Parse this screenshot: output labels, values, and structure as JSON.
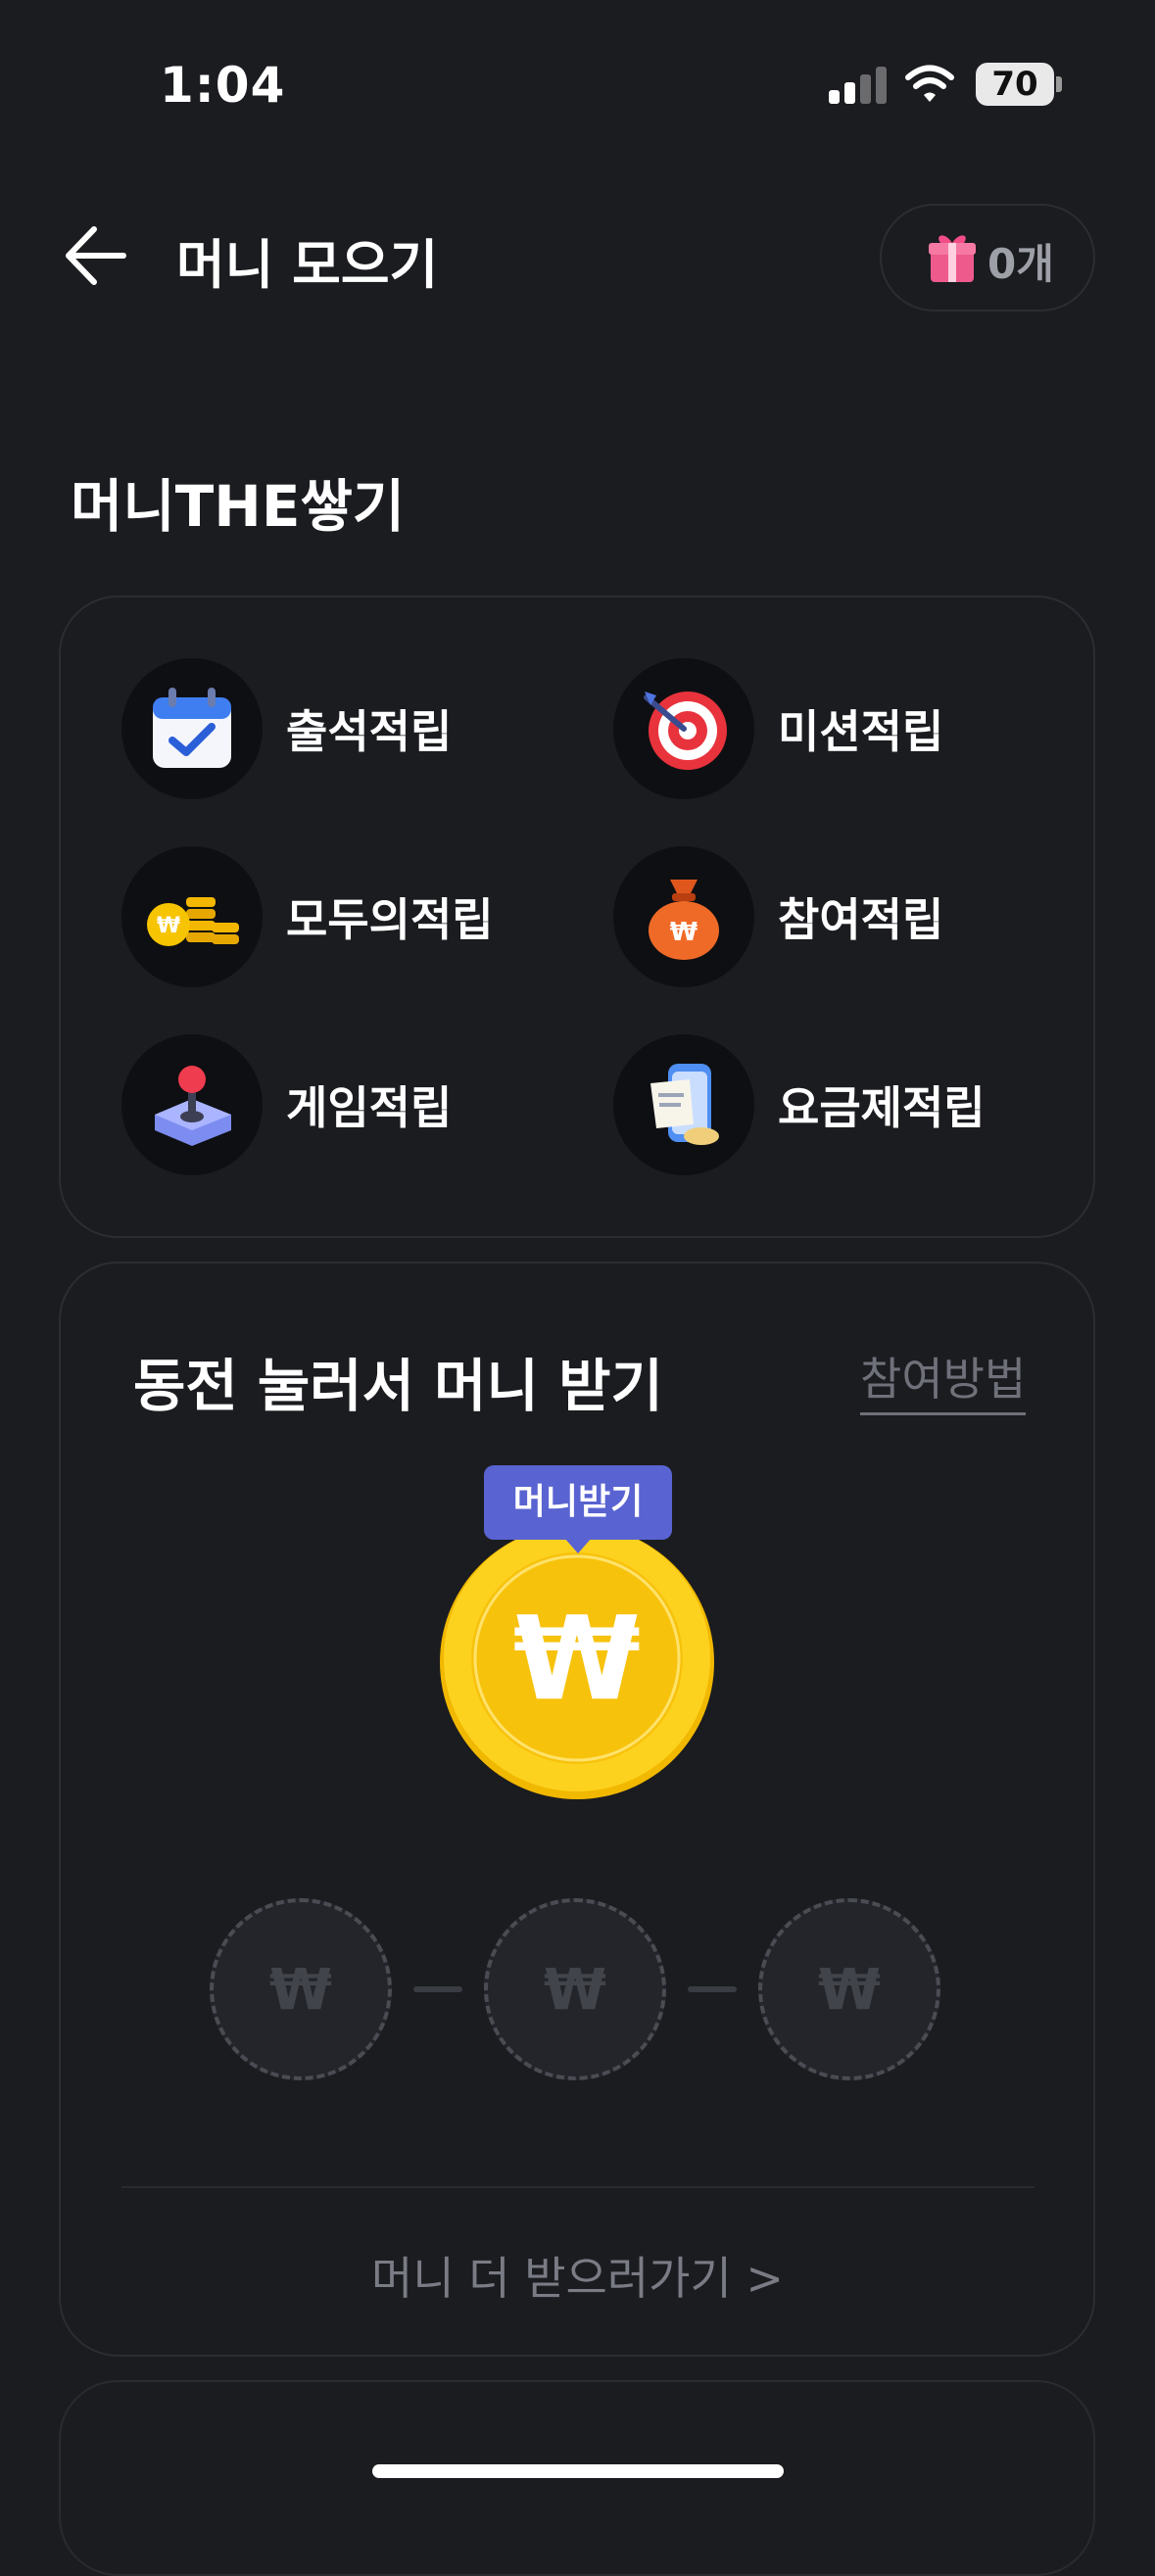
{
  "status_bar": {
    "time": "1:04",
    "battery": "70"
  },
  "header": {
    "title": "머니 모으기",
    "gift_count": "0개"
  },
  "section_title": "머니THE쌓기",
  "earn_items": [
    {
      "label": "출석적립",
      "icon": "calendar-check-icon"
    },
    {
      "label": "미션적립",
      "icon": "target-dart-icon"
    },
    {
      "label": "모두의적립",
      "icon": "coin-stack-icon"
    },
    {
      "label": "참여적립",
      "icon": "money-bag-icon"
    },
    {
      "label": "게임적립",
      "icon": "joystick-icon"
    },
    {
      "label": "요금제적립",
      "icon": "phone-receipt-icon"
    }
  ],
  "coin_section": {
    "title": "동전 눌러서 머니 받기",
    "how_link": "참여방법",
    "tooltip": "머니받기",
    "slots": [
      "₩",
      "₩",
      "₩"
    ],
    "more_link": "머니 더 받으러가기 >"
  },
  "colors": {
    "background": "#1b1c20",
    "tooltip": "#5963d1",
    "coin": "#f6c400"
  }
}
